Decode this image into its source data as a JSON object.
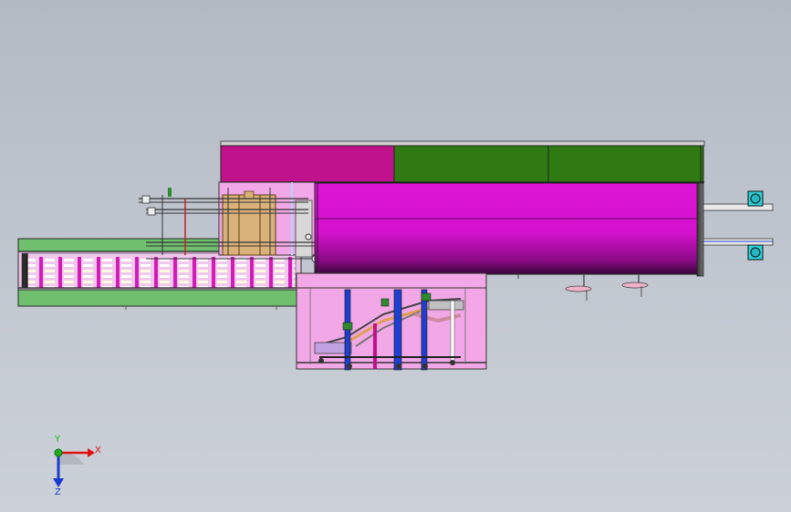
{
  "viewport": {
    "background_top": "#b3bac4",
    "background_bottom": "#ccd1d9"
  },
  "model": {
    "top_housing_colors": [
      "#c0128a",
      "#2f7a12",
      "#2f7a12"
    ],
    "drum_color": "#dd14d6",
    "conveyor_color": "#6fbf6f",
    "frame_color": "#f2a8e6",
    "tray_color": "#f0c8ec",
    "rod_colors": [
      "#1f3fd0",
      "#c0128a",
      "#2f8a2f",
      "#9a4a20"
    ],
    "end_cap_color": "#2ad0d8"
  },
  "triad": {
    "x_label": "X",
    "y_label": "Y",
    "z_label": "Z",
    "x_color": "#e01010",
    "y_color": "#18b018",
    "z_color": "#1a3ad0"
  }
}
